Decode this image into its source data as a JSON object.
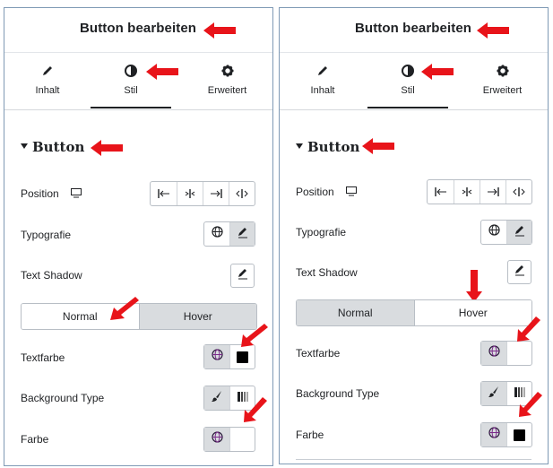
{
  "colors": {
    "arrow": "#e8141a",
    "border": "#7f9ab5",
    "active_seg": "#d9dcdf"
  },
  "panel_left": {
    "header_title": "Button bearbeiten",
    "tabs": [
      {
        "label": "Inhalt",
        "icon": "pencil-icon"
      },
      {
        "label": "Stil",
        "icon": "contrast-icon",
        "active": true
      },
      {
        "label": "Erweitert",
        "icon": "gear-icon"
      }
    ],
    "section_title": "Button",
    "position_label": "Position",
    "typografie_label": "Typografie",
    "text_shadow_label": "Text Shadow",
    "state_tabs": [
      "Normal",
      "Hover"
    ],
    "active_state": "Normal",
    "textfarbe_label": "Textfarbe",
    "background_type_label": "Background Type",
    "farbe_label": "Farbe"
  },
  "panel_right": {
    "header_title": "Button bearbeiten",
    "tabs": [
      {
        "label": "Inhalt",
        "icon": "pencil-icon"
      },
      {
        "label": "Stil",
        "icon": "contrast-icon",
        "active": true
      },
      {
        "label": "Erweitert",
        "icon": "gear-icon"
      }
    ],
    "section_title": "Button",
    "position_label": "Position",
    "typografie_label": "Typografie",
    "text_shadow_label": "Text Shadow",
    "state_tabs": [
      "Normal",
      "Hover"
    ],
    "active_state": "Hover",
    "textfarbe_label": "Textfarbe",
    "background_type_label": "Background Type",
    "farbe_label": "Farbe"
  }
}
